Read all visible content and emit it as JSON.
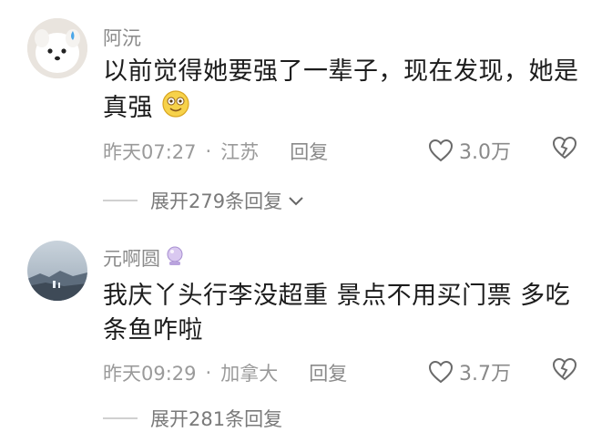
{
  "comments": [
    {
      "username": "阿沅",
      "text": "以前觉得她要强了一辈子，现在发现，她是真强",
      "time": "昨天07:27",
      "location": "江苏",
      "reply_label": "回复",
      "likes": "3.0万",
      "expand_label": "展开279条回复"
    },
    {
      "username": "元啊圆",
      "text": "我庆丫头行李没超重 景点不用买门票 多吃条鱼咋啦",
      "time": "昨天09:29",
      "location": "加拿大",
      "reply_label": "回复",
      "likes": "3.7万",
      "expand_label": "展开281条回复"
    }
  ],
  "separator": "·"
}
